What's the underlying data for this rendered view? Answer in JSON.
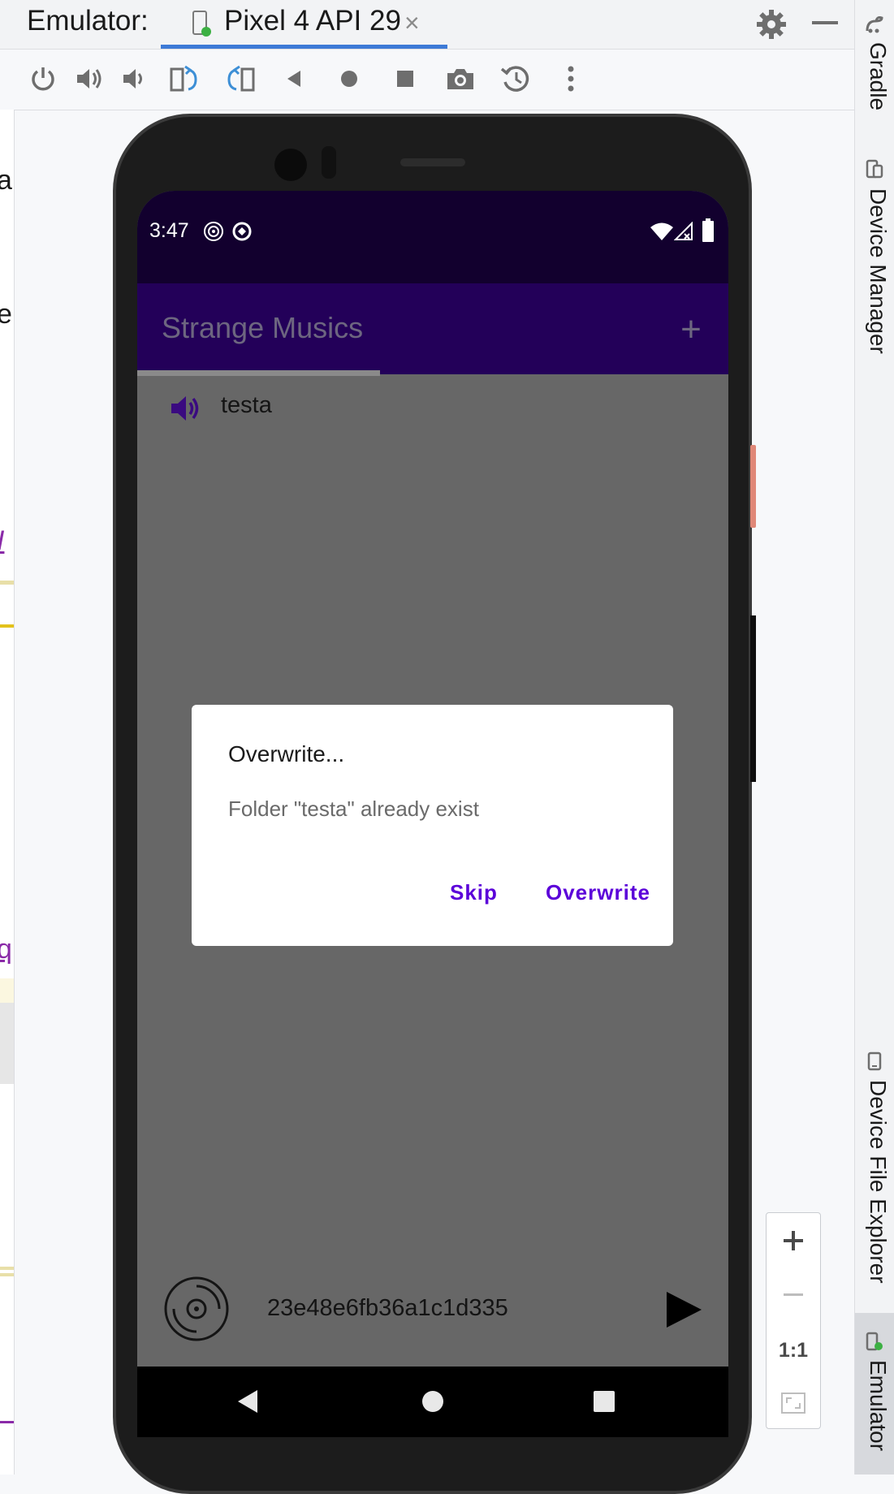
{
  "ide": {
    "title": "Emulator:",
    "device_tab": {
      "label": "Pixel 4 API 29",
      "close_glyph": "×"
    },
    "toolbar": {
      "icons": [
        "power-icon",
        "volume-up-icon",
        "volume-down-icon",
        "rotate-left-icon",
        "rotate-right-icon",
        "back-icon",
        "home-icon",
        "overview-icon",
        "screenshot-icon",
        "snapshot-icon",
        "more-icon"
      ]
    },
    "left_strip_glyphs": [
      "a",
      "e",
      "I",
      "q"
    ],
    "right_panel": {
      "gradle": "Gradle",
      "device_manager": "Device Manager",
      "device_file_explorer": "Device File Explorer",
      "emulator": "Emulator"
    },
    "zoom": {
      "one_to_one": "1:1"
    }
  },
  "phone": {
    "status_time": "3:47",
    "app_title": "Strange Musics",
    "add_glyph": "+",
    "list": [
      {
        "label": "testa"
      }
    ],
    "dialog": {
      "title": "Overwrite...",
      "message": "Folder \"testa\" already exist",
      "skip_label": "Skip",
      "overwrite_label": "Overwrite"
    },
    "player": {
      "track": "23e48e6fb36a1c1d335"
    }
  },
  "colors": {
    "status_bar": "#12002e",
    "app_bar": "#230059",
    "accent": "#5b00d9",
    "tab_underline": "#3d7ad6"
  }
}
